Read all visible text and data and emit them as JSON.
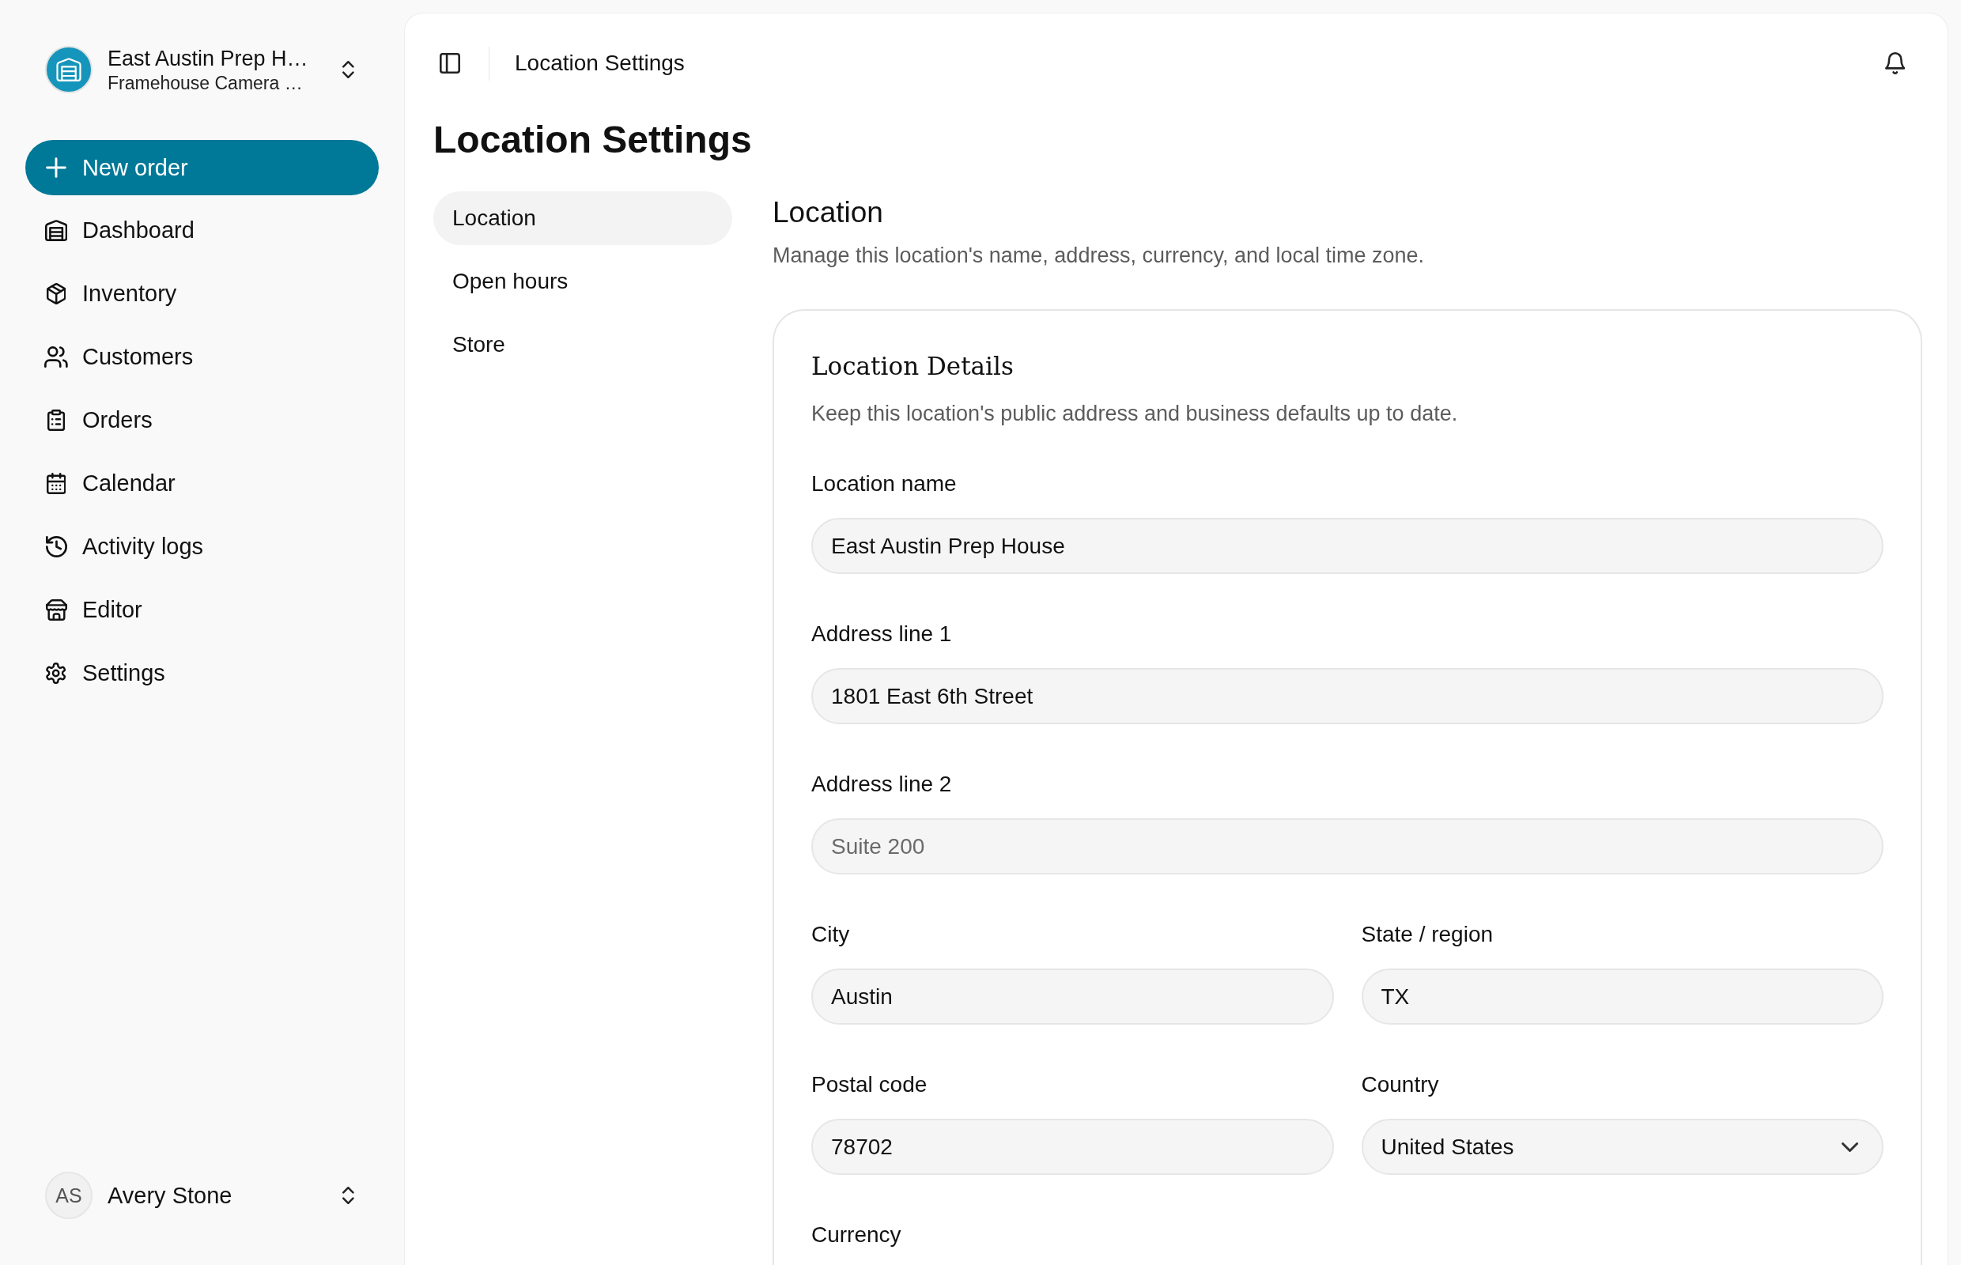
{
  "workspace": {
    "name": "East Austin Prep H…",
    "subtitle": "Framehouse Camera …"
  },
  "new_order": {
    "label": "New order"
  },
  "sidebar": {
    "items": [
      {
        "label": "Dashboard",
        "selected": false
      },
      {
        "label": "Inventory",
        "selected": false
      },
      {
        "label": "Customers",
        "selected": false
      },
      {
        "label": "Orders",
        "selected": false
      },
      {
        "label": "Calendar",
        "selected": false
      },
      {
        "label": "Activity logs",
        "selected": false
      },
      {
        "label": "Editor",
        "selected": false
      },
      {
        "label": "Settings",
        "selected": false
      }
    ]
  },
  "user": {
    "initials": "AS",
    "name": "Avery Stone"
  },
  "header": {
    "breadcrumb": "Location Settings"
  },
  "page_title": "Location Settings",
  "subnav": {
    "items": [
      {
        "label": "Location",
        "selected": true
      },
      {
        "label": "Open hours",
        "selected": false
      },
      {
        "label": "Store",
        "selected": false
      }
    ]
  },
  "section": {
    "title": "Location",
    "description": "Manage this location's name, address, currency, and local time zone."
  },
  "card": {
    "title": "Location Details",
    "description": "Keep this location's public address and business defaults up to date.",
    "rows": [
      {
        "fields": [
          {
            "label": "Location name",
            "kind": "text",
            "value": "East Austin Prep House"
          }
        ]
      },
      {
        "fields": [
          {
            "label": "Address line 1",
            "kind": "text",
            "value": "1801 East 6th Street"
          }
        ]
      },
      {
        "fields": [
          {
            "label": "Address line 2",
            "kind": "text",
            "placeholder": "Suite 200"
          }
        ]
      },
      {
        "fields": [
          {
            "label": "City",
            "kind": "text",
            "value": "Austin"
          },
          {
            "label": "State / region",
            "kind": "text",
            "value": "TX"
          }
        ]
      },
      {
        "fields": [
          {
            "label": "Postal code",
            "kind": "text",
            "value": "78702"
          },
          {
            "label": "Country",
            "kind": "select",
            "value": "United States"
          }
        ]
      },
      {
        "fields": [
          {
            "label": "Currency"
          }
        ]
      }
    ]
  }
}
